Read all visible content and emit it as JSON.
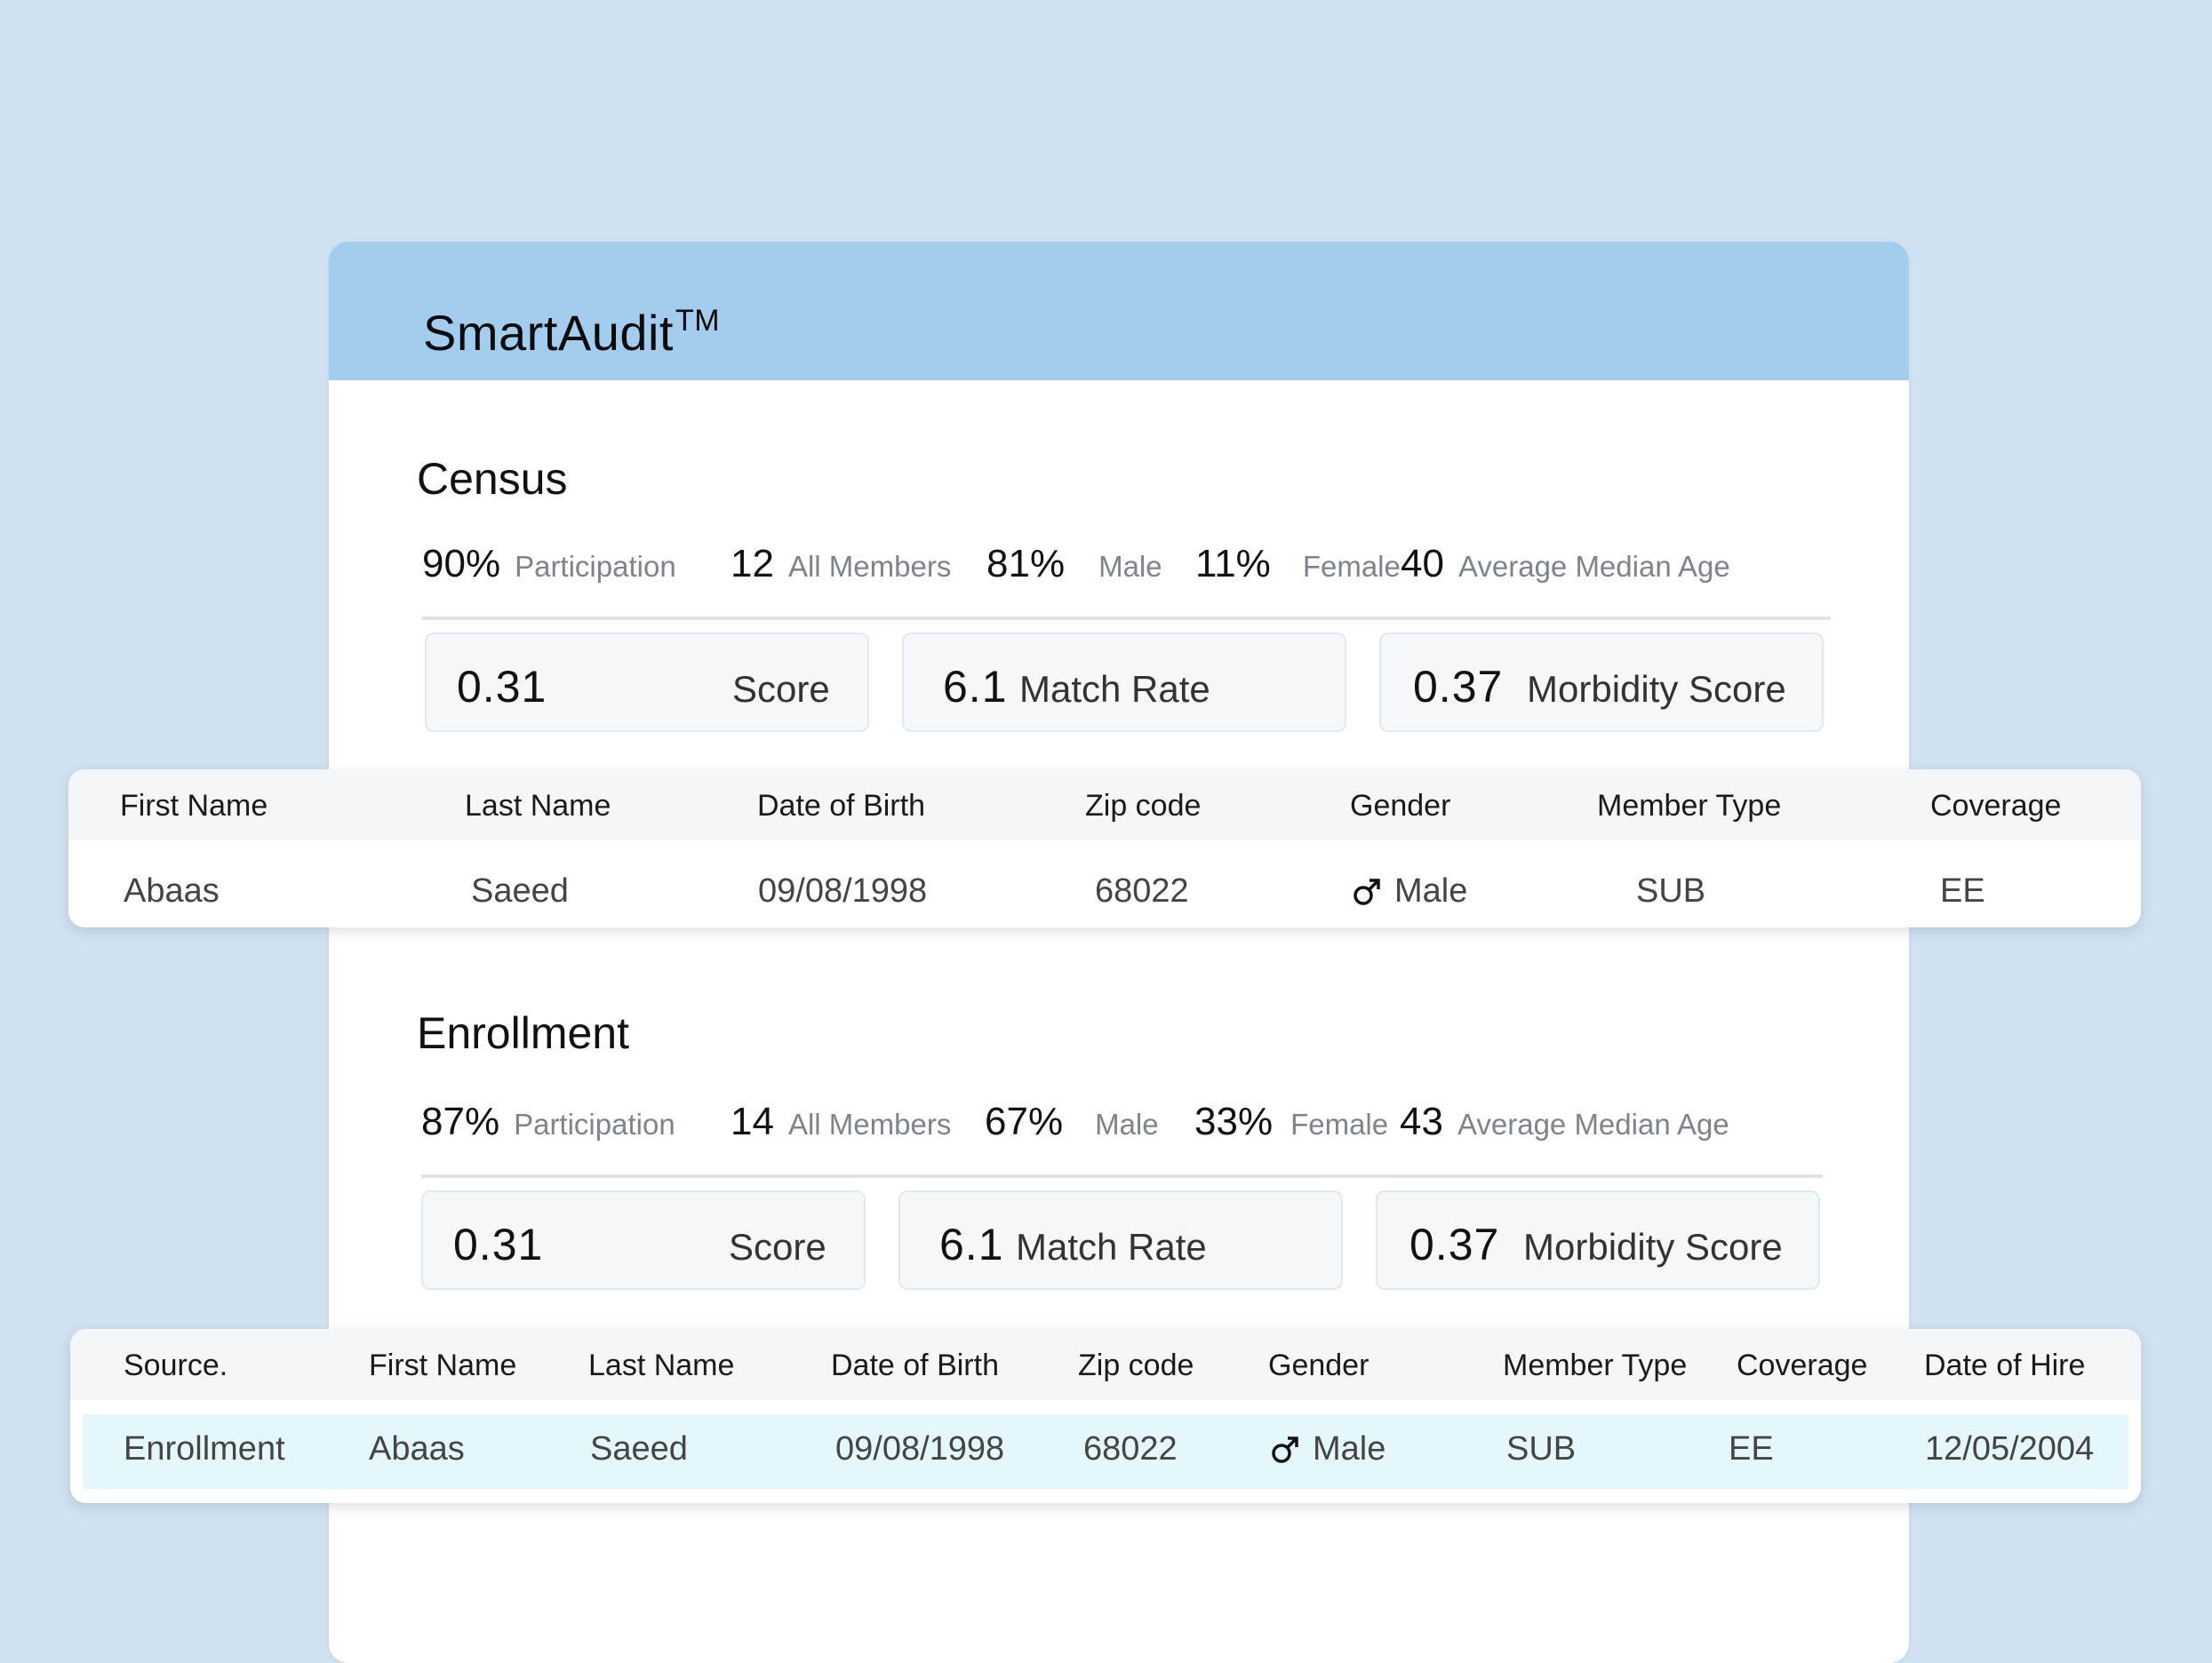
{
  "app": {
    "title": "SmartAudit",
    "trademark": "TM"
  },
  "census": {
    "title": "Census",
    "stats": [
      {
        "value": "90%",
        "label": "Participation"
      },
      {
        "value": "12",
        "label": "All Members"
      },
      {
        "value": "81%",
        "label": "Male"
      },
      {
        "value": "11%",
        "label": "Female"
      },
      {
        "value": "40",
        "label": "Average Median Age"
      }
    ],
    "cards": [
      {
        "value": "0.31",
        "label": "Score"
      },
      {
        "value": "6.1",
        "label": "Match Rate"
      },
      {
        "value": "0.37",
        "label": "Morbidity Score"
      }
    ],
    "table": {
      "headers": [
        "First Name",
        "Last Name",
        "Date of Birth",
        "Zip code",
        "Gender",
        "Member Type",
        "Coverage"
      ],
      "row": {
        "first_name": "Abaas",
        "last_name": "Saeed",
        "dob": "09/08/1998",
        "zip": "68022",
        "gender": "Male",
        "member_type": "SUB",
        "coverage": "EE"
      }
    }
  },
  "enrollment": {
    "title": "Enrollment",
    "stats": [
      {
        "value": "87%",
        "label": "Participation"
      },
      {
        "value": "14",
        "label": "All Members"
      },
      {
        "value": "67%",
        "label": "Male"
      },
      {
        "value": "33%",
        "label": "Female"
      },
      {
        "value": "43",
        "label": "Average Median Age"
      }
    ],
    "cards": [
      {
        "value": "0.31",
        "label": "Score"
      },
      {
        "value": "6.1",
        "label": "Match Rate"
      },
      {
        "value": "0.37",
        "label": "Morbidity Score"
      }
    ],
    "table": {
      "headers": [
        "Source.",
        "First Name",
        "Last Name",
        "Date of Birth",
        "Zip code",
        "Gender",
        "Member Type",
        "Coverage",
        "Date of Hire"
      ],
      "row": {
        "source": "Enrollment",
        "first_name": "Abaas",
        "last_name": "Saeed",
        "dob": "09/08/1998",
        "zip": "68022",
        "gender": "Male",
        "member_type": "SUB",
        "coverage": "EE",
        "date_of_hire": "12/05/2004"
      }
    }
  },
  "icons": {
    "gender_male": "male-symbol-icon"
  },
  "colors": {
    "background": "#d0e2f1",
    "header": "#a3cdee",
    "row_highlight": "#e4f8fc",
    "muted_label": "#7d848b"
  }
}
